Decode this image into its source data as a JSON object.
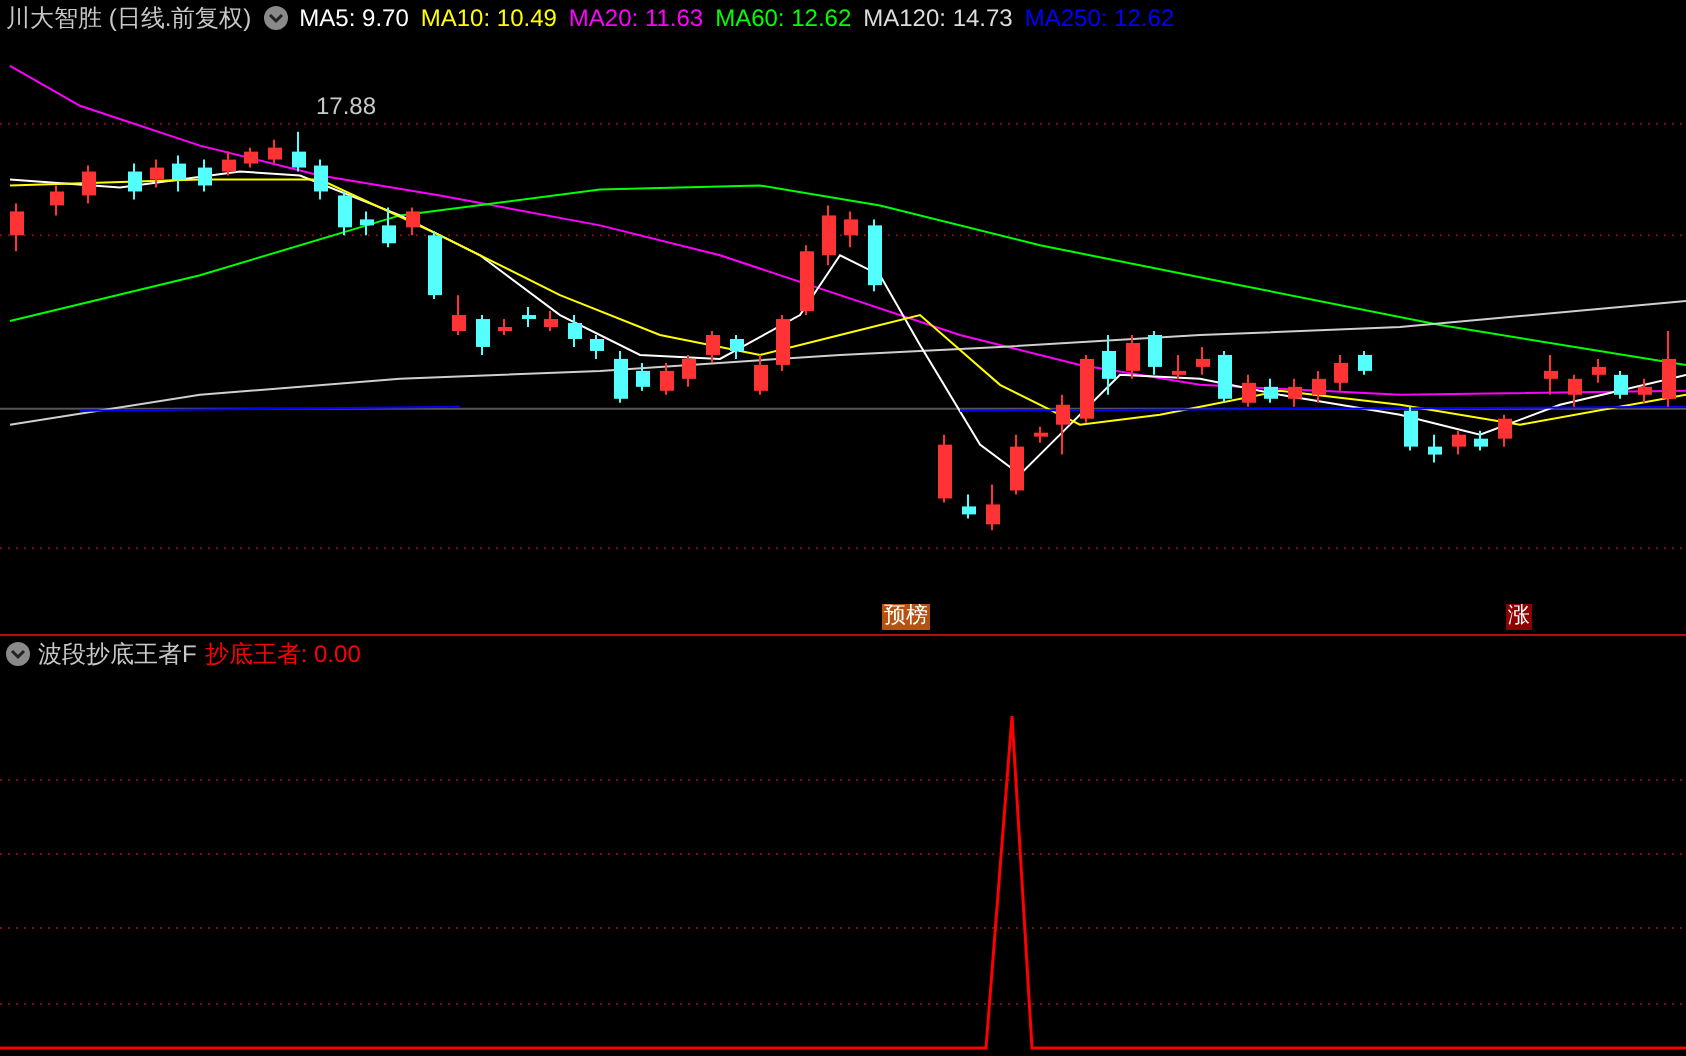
{
  "title": "川大智胜 (日线.前复权)",
  "moving_averages": [
    {
      "text": "MA5: 9.70",
      "color": "#ffffff"
    },
    {
      "text": "MA10: 10.49",
      "color": "#ffff00"
    },
    {
      "text": "MA20: 11.63",
      "color": "#ff00ff"
    },
    {
      "text": "MA60: 12.62",
      "color": "#00ff00"
    },
    {
      "text": "MA120: 14.73",
      "color": "#dcdcdc"
    },
    {
      "text": "MA250: 12.62",
      "color": "#0000ff"
    }
  ],
  "price_marker": "17.88",
  "signals": [
    {
      "text": "预榜",
      "color": "#b5520f"
    },
    {
      "text": "涨",
      "color": "#8b0000"
    }
  ],
  "indicator": {
    "title": "波段抄底王者F",
    "readings": [
      {
        "text": "抄底王者: 0.00",
        "color": "#ff0000"
      }
    ]
  }
}
